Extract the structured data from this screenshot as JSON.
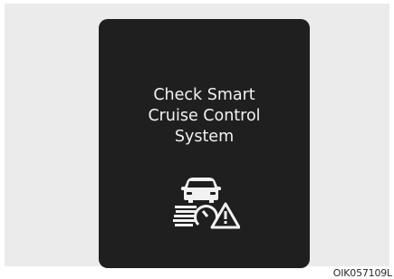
{
  "display": {
    "message_lines": [
      "Check Smart",
      "Cruise Control",
      "System"
    ],
    "icon": "smart-cruise-control-warning-icon"
  },
  "figure": {
    "code": "OIK057109L"
  },
  "colors": {
    "screen_background": "#1f1f1f",
    "text": "#f2f2f2",
    "frame_background": "#ebebeb"
  }
}
